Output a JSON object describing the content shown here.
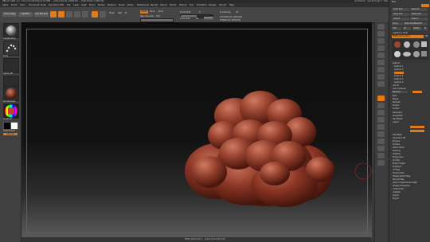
{
  "window": {
    "title": "ZBrush 2021.1.2 · Cloud Sculpt Project 01.ZPR — Active Points: 0.804 Mil — Total Points: 0.804 Mil",
    "right_status": "QuickSave · See-through 0 · Menus · DefaultZScript"
  },
  "menubar": {
    "items": [
      "Alpha",
      "Brush",
      "Color",
      "Document",
      "Draw",
      "Dynamics",
      "Edit",
      "File",
      "Layer",
      "Light",
      "Macro",
      "Marker",
      "Material",
      "Movie",
      "Picker",
      "Preferences",
      "Render",
      "Stencil",
      "Stroke",
      "Texture",
      "Tool",
      "Transform",
      "Zplugin",
      "Zscript",
      "Help"
    ]
  },
  "toolbar": {
    "home_page": "Home Page",
    "lightbox": "LightBox",
    "live_boolean": "Live Boolean",
    "edit": "Edit",
    "draw": "Draw",
    "move": "Move",
    "scale": "Scale",
    "rotate": "Rotate",
    "mrgb": "Mrgb",
    "rgb": "Rgb",
    "m": "M",
    "zadd": "Zadd",
    "zsub": "Zsub",
    "zcut": "Zcut",
    "focal_shift_label": "Focal Shift",
    "focal_shift_value": "0",
    "draw_size_label": "Draw Size",
    "draw_size_value": "64",
    "dynamic": "Dynamic",
    "z_intensity_label": "Z Intensity",
    "z_intensity_value": "25",
    "rgb_intensity_label": "Rgb Intensity",
    "rgb_intensity_value": "100",
    "active_points": "ActivePoints: 804,001",
    "total_points": "TotalPoints: 804,001"
  },
  "left_shelf": {
    "brush_label": "ClayBuildup",
    "stroke_label": "Dots",
    "alpha_label": "Alpha Off",
    "texture_label": "Texture Off",
    "material_label": "SkinShade4",
    "gradient_label": "Gradient",
    "switch_color": "SwitchColor",
    "alternate": "Alternate"
  },
  "right_panel": {
    "header": "Tool",
    "load_tool": "Load Tool",
    "save_as": "Save As",
    "copy_tool": "Copy Tool",
    "paste_tool": "Paste Tool",
    "import": "Import",
    "export": "Export",
    "clone": "Clone",
    "make_polymesh": "Make PolyMesh3D",
    "goz": "GoZ",
    "all": "All",
    "visible": "Visible",
    "r": "R",
    "lightbox_tools": "Lightbox ▸ Tools",
    "current_tool": "PM3D_Sphere3D_1",
    "tool_count": "48",
    "sections": [
      "Subtool",
      "Geometry",
      "ArrayMesh",
      "NanoMesh",
      "Layers",
      "FiberMesh",
      "Geometry HD",
      "Preview",
      "Surface",
      "Deformation",
      "Masking",
      "Visibility",
      "Polygroups",
      "Contact",
      "Morph Target",
      "Polypaint",
      "UV Map",
      "Texture Map",
      "Displacement Map",
      "Normal Map",
      "Vector Displacement Map",
      "Display Properties",
      "Unified Skin",
      "Initialize",
      "Import",
      "Export"
    ],
    "subtool_items": [
      "Subtool 1",
      "Subtool 2",
      "Subtool 3",
      "Subtool 4",
      "Subtool 5",
      "Subtool 6"
    ],
    "list_all": "List All",
    "auto_collapse": "Auto Collapse",
    "rename": "Rename",
    "split": "Split",
    "merge": "Merge",
    "remesh": "Remesh",
    "project": "Project",
    "extract": "Extract"
  },
  "status": {
    "bottom": "PM3D_Sphere3D_1 · Active Points 804,001"
  },
  "colors": {
    "accent": "#e07a1a",
    "clay": "#8a3524",
    "bg": "#3a3a3a"
  }
}
